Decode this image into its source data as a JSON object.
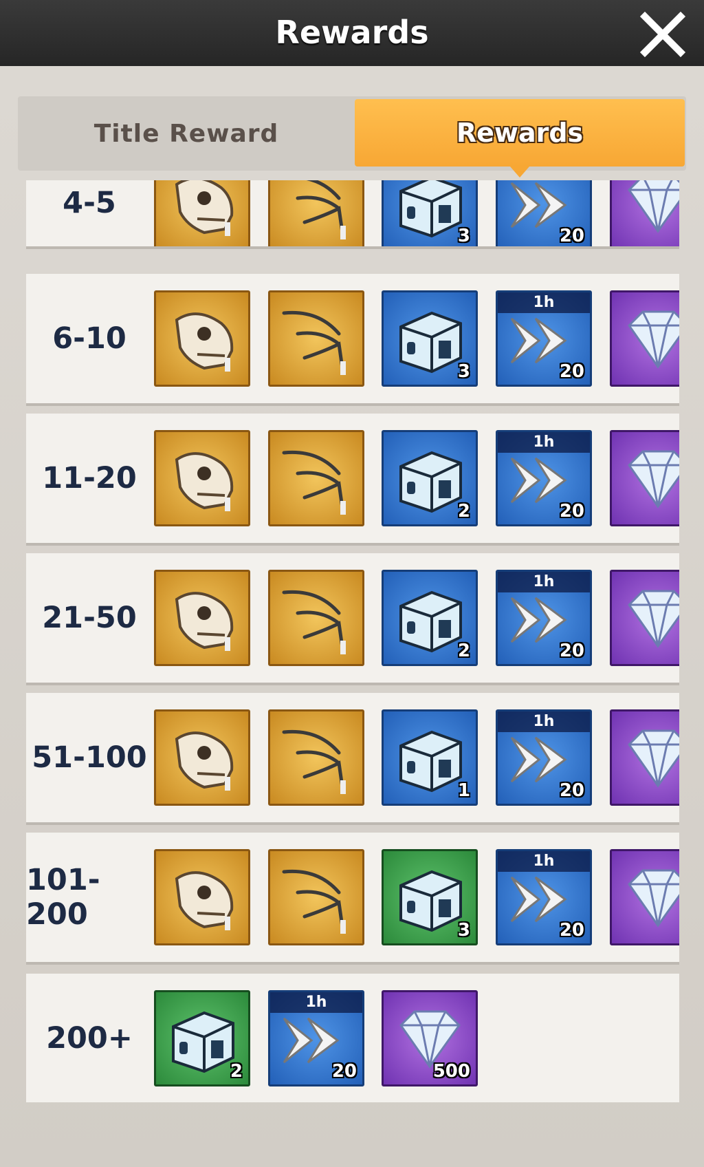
{
  "header": {
    "title": "Rewards"
  },
  "tabs": {
    "title_reward": "Title Reward",
    "rewards": "Rewards"
  },
  "colors": {
    "accent": "#f7a734",
    "rank_text": "#1d2a44"
  },
  "rows": [
    {
      "rank": "4-5",
      "items": [
        {
          "icon": "dino-skull-icon",
          "tier": "gold",
          "qty": ""
        },
        {
          "icon": "fossil-claw-icon",
          "tier": "gold",
          "qty": ""
        },
        {
          "icon": "crate-icon",
          "tier": "blue",
          "qty": "3"
        },
        {
          "icon": "speedup-icon",
          "tier": "blue",
          "qty": "20",
          "tag": ""
        },
        {
          "icon": "diamond-icon",
          "tier": "purple",
          "qty": ""
        }
      ]
    },
    {
      "rank": "6-10",
      "items": [
        {
          "icon": "dino-skull-icon",
          "tier": "gold",
          "qty": ""
        },
        {
          "icon": "fossil-claw-icon",
          "tier": "gold",
          "qty": ""
        },
        {
          "icon": "crate-icon",
          "tier": "blue",
          "qty": "3"
        },
        {
          "icon": "speedup-icon",
          "tier": "blue",
          "qty": "20",
          "tag": "1h"
        },
        {
          "icon": "diamond-icon",
          "tier": "purple",
          "qty": ""
        }
      ]
    },
    {
      "rank": "11-20",
      "items": [
        {
          "icon": "dino-skull-icon",
          "tier": "gold",
          "qty": ""
        },
        {
          "icon": "fossil-claw-icon",
          "tier": "gold",
          "qty": ""
        },
        {
          "icon": "crate-icon",
          "tier": "blue",
          "qty": "2"
        },
        {
          "icon": "speedup-icon",
          "tier": "blue",
          "qty": "20",
          "tag": "1h"
        },
        {
          "icon": "diamond-icon",
          "tier": "purple",
          "qty": ""
        }
      ]
    },
    {
      "rank": "21-50",
      "items": [
        {
          "icon": "dino-skull-icon",
          "tier": "gold",
          "qty": ""
        },
        {
          "icon": "fossil-claw-icon",
          "tier": "gold",
          "qty": ""
        },
        {
          "icon": "crate-icon",
          "tier": "blue",
          "qty": "2"
        },
        {
          "icon": "speedup-icon",
          "tier": "blue",
          "qty": "20",
          "tag": "1h"
        },
        {
          "icon": "diamond-icon",
          "tier": "purple",
          "qty": ""
        }
      ]
    },
    {
      "rank": "51-100",
      "items": [
        {
          "icon": "dino-skull-icon",
          "tier": "gold",
          "qty": ""
        },
        {
          "icon": "fossil-claw-icon",
          "tier": "gold",
          "qty": ""
        },
        {
          "icon": "crate-icon",
          "tier": "blue",
          "qty": "1"
        },
        {
          "icon": "speedup-icon",
          "tier": "blue",
          "qty": "20",
          "tag": "1h"
        },
        {
          "icon": "diamond-icon",
          "tier": "purple",
          "qty": ""
        }
      ]
    },
    {
      "rank": "101-200",
      "items": [
        {
          "icon": "dino-skull-icon",
          "tier": "gold",
          "qty": ""
        },
        {
          "icon": "fossil-claw-icon",
          "tier": "gold",
          "qty": ""
        },
        {
          "icon": "crate-icon",
          "tier": "green",
          "qty": "3"
        },
        {
          "icon": "speedup-icon",
          "tier": "blue",
          "qty": "20",
          "tag": "1h"
        },
        {
          "icon": "diamond-icon",
          "tier": "purple",
          "qty": ""
        }
      ]
    },
    {
      "rank": "200+",
      "items": [
        {
          "icon": "crate-icon",
          "tier": "green",
          "qty": "2"
        },
        {
          "icon": "speedup-icon",
          "tier": "blue",
          "qty": "20",
          "tag": "1h"
        },
        {
          "icon": "diamond-icon",
          "tier": "purple",
          "qty": "500"
        }
      ]
    }
  ]
}
